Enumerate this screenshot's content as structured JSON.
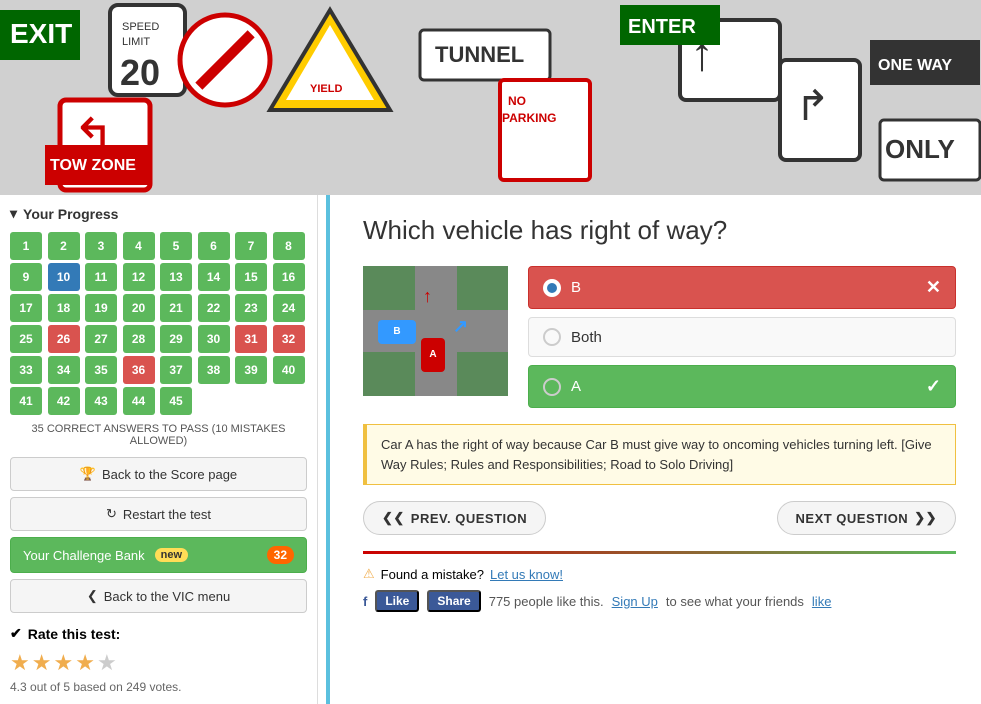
{
  "hero": {
    "alt": "Traffic signs collage"
  },
  "sidebar": {
    "progress_header": "Your Progress",
    "grid": {
      "cells": [
        {
          "num": 1,
          "state": "green"
        },
        {
          "num": 2,
          "state": "green"
        },
        {
          "num": 3,
          "state": "green"
        },
        {
          "num": 4,
          "state": "green"
        },
        {
          "num": 5,
          "state": "green"
        },
        {
          "num": 6,
          "state": "green"
        },
        {
          "num": 7,
          "state": "green"
        },
        {
          "num": 8,
          "state": "green"
        },
        {
          "num": 9,
          "state": "green"
        },
        {
          "num": 10,
          "state": "blue"
        },
        {
          "num": 11,
          "state": "green"
        },
        {
          "num": 12,
          "state": "green"
        },
        {
          "num": 13,
          "state": "green"
        },
        {
          "num": 14,
          "state": "green"
        },
        {
          "num": 15,
          "state": "green"
        },
        {
          "num": 16,
          "state": "green"
        },
        {
          "num": 17,
          "state": "green"
        },
        {
          "num": 18,
          "state": "green"
        },
        {
          "num": 19,
          "state": "green"
        },
        {
          "num": 20,
          "state": "green"
        },
        {
          "num": 21,
          "state": "green"
        },
        {
          "num": 22,
          "state": "green"
        },
        {
          "num": 23,
          "state": "green"
        },
        {
          "num": 24,
          "state": "green"
        },
        {
          "num": 25,
          "state": "green"
        },
        {
          "num": 26,
          "state": "red"
        },
        {
          "num": 27,
          "state": "green"
        },
        {
          "num": 28,
          "state": "green"
        },
        {
          "num": 29,
          "state": "green"
        },
        {
          "num": 30,
          "state": "green"
        },
        {
          "num": 31,
          "state": "red"
        },
        {
          "num": 32,
          "state": "red"
        },
        {
          "num": 33,
          "state": "green"
        },
        {
          "num": 34,
          "state": "green"
        },
        {
          "num": 35,
          "state": "green"
        },
        {
          "num": 36,
          "state": "red"
        },
        {
          "num": 37,
          "state": "green"
        },
        {
          "num": 38,
          "state": "green"
        },
        {
          "num": 39,
          "state": "green"
        },
        {
          "num": 40,
          "state": "green"
        },
        {
          "num": 41,
          "state": "green"
        },
        {
          "num": 42,
          "state": "green"
        },
        {
          "num": 43,
          "state": "green"
        },
        {
          "num": 44,
          "state": "green"
        },
        {
          "num": 45,
          "state": "green"
        },
        {
          "num": "",
          "state": "empty"
        },
        {
          "num": "",
          "state": "empty"
        },
        {
          "num": "",
          "state": "empty"
        }
      ]
    },
    "pass_text": "35 CORRECT ANSWERS TO PASS (10 MISTAKES ALLOWED)",
    "btn_score": "Back to the Score page",
    "btn_restart": "Restart the test",
    "btn_challenge": "Your Challenge Bank",
    "challenge_badge": "new",
    "challenge_count": "32",
    "btn_back": "Back to the VIC menu",
    "rate_header": "Rate this test:",
    "stars": [
      1,
      1,
      1,
      1,
      0
    ],
    "rate_text": "4.3 out of 5 based on 249 votes."
  },
  "question": {
    "title": "Which vehicle has right of way?",
    "options": [
      {
        "label": "B",
        "state": "wrong",
        "selected": true
      },
      {
        "label": "Both",
        "state": "neutral",
        "selected": false
      },
      {
        "label": "A",
        "state": "correct",
        "selected": false
      }
    ],
    "explanation": "Car A has the right of way because Car B must give way to oncoming vehicles turning left. [Give Way Rules; Rules and Responsibilities; Road to Solo Driving]",
    "nav": {
      "prev": "PREV. QUESTION",
      "next": "NEXT QUESTION"
    },
    "feedback": {
      "icon": "⚠",
      "text": "Found a mistake? Let us know!",
      "link": "Let us know!"
    },
    "social": {
      "like": "Like",
      "share": "Share",
      "count": "775 people like this.",
      "signup": "Sign Up",
      "signup_text": "to see what your friends",
      "like_word": "like"
    }
  }
}
